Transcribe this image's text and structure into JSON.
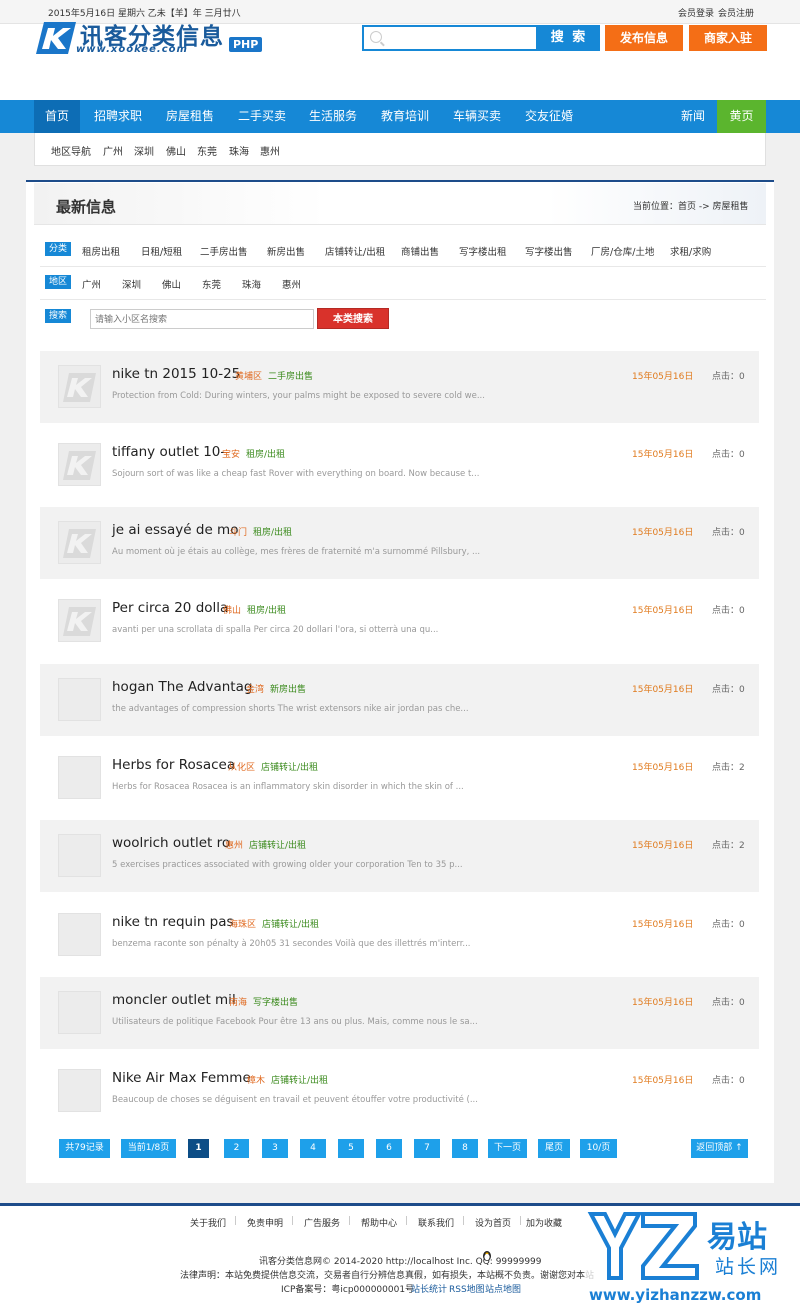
{
  "topbar": {
    "date": "2015年5月16日 星期六 乙未【羊】年 三月廿八",
    "login": "会员登录",
    "register": "会员注册"
  },
  "logo": {
    "name": "讯客分类信息",
    "url": "www.xookee.com",
    "badge": "PHP"
  },
  "search": {
    "placeholder": "",
    "button": "搜 索"
  },
  "header_buttons": {
    "publish": "发布信息",
    "merchant": "商家入驻"
  },
  "nav": {
    "items": [
      "首页",
      "招聘求职",
      "房屋租售",
      "二手买卖",
      "生活服务",
      "教育培训",
      "车辆买卖",
      "交友征婚"
    ],
    "news": "新闻",
    "yellow_pages": "黄页"
  },
  "region_nav": {
    "label": "地区导航",
    "items": [
      "广州",
      "深圳",
      "佛山",
      "东莞",
      "珠海",
      "惠州"
    ]
  },
  "latest": {
    "title": "最新信息",
    "breadcrumb": "当前位置：首页 -> 房屋租售"
  },
  "filters": {
    "category_tag": "分类",
    "categories": [
      "租房出租",
      "日租/短租",
      "二手房出售",
      "新房出售",
      "店铺转让/出租",
      "商铺出售",
      "写字楼出租",
      "写字楼出售",
      "厂房/仓库/土地",
      "求租/求购"
    ],
    "area_tag": "地区",
    "areas": [
      "广州",
      "深圳",
      "佛山",
      "东莞",
      "珠海",
      "惠州"
    ],
    "search_tag": "搜索",
    "keyword_placeholder": "请输入小区名搜索",
    "keyword_button": "本类搜索"
  },
  "listings": [
    {
      "title": "nike tn 2015 10-25",
      "area": "黄埔区",
      "category": "二手房出售",
      "desc": "Protection from Cold: During winters, your palms might be exposed to severe cold we...",
      "date": "15年05月16日",
      "clicks": "点击：0"
    },
    {
      "title": "tiffany outlet 10-",
      "area": "宝安",
      "category": "租房/出租",
      "desc": "Sojourn sort of was like a cheap fast Rover with everything on board. Now because t...",
      "date": "15年05月16日",
      "clicks": "点击：0"
    },
    {
      "title": "je ai essayé de mo",
      "area": "斗门",
      "category": "租房/出租",
      "desc": "Au moment où je étais au collège, mes frères de fraternité m'a surnommé Pillsbury, ...",
      "date": "15年05月16日",
      "clicks": "点击：0"
    },
    {
      "title": "Per circa 20 dolla",
      "area": "佛山",
      "category": "租房/出租",
      "desc": "avanti per una scrollata di spalla Per circa 20 dollari l'ora, si otterrà una qu...",
      "date": "15年05月16日",
      "clicks": "点击：0"
    },
    {
      "title": "hogan The Advantag",
      "area": "金湾",
      "category": "新房出售",
      "desc": "the advantages of compression shorts The wrist extensors nike air jordan pas che...",
      "date": "15年05月16日",
      "clicks": "点击：0"
    },
    {
      "title": "Herbs for Rosacea",
      "area": "从化区",
      "category": "店铺转让/出租",
      "desc": "Herbs for Rosacea Rosacea is an inflammatory skin disorder in which the skin of ...",
      "date": "15年05月16日",
      "clicks": "点击：2"
    },
    {
      "title": "woolrich outlet ro",
      "area": "惠州",
      "category": "店铺转让/出租",
      "desc": "5 exercises practices associated with growing older your corporation Ten to 35 p...",
      "date": "15年05月16日",
      "clicks": "点击：2"
    },
    {
      "title": "nike tn requin pas",
      "area": "海珠区",
      "category": "店铺转让/出租",
      "desc": "benzema raconte son pénalty à 20h05 31 secondes Voilà que des illettrés m'interr...",
      "date": "15年05月16日",
      "clicks": "点击：0"
    },
    {
      "title": "moncler outlet mil",
      "area": "南海",
      "category": "写字楼出售",
      "desc": "Utilisateurs de politique Facebook Pour être 13 ans ou plus. Mais, comme nous le sa...",
      "date": "15年05月16日",
      "clicks": "点击：0"
    },
    {
      "title": "Nike Air Max Femme",
      "area": "樟木",
      "category": "店铺转让/出租",
      "desc": "Beaucoup de choses se déguisent en travail et peuvent étouffer votre productivité (...",
      "date": "15年05月16日",
      "clicks": "点击：0"
    }
  ],
  "pagination": {
    "total": "共79记录",
    "current": "当前1/8页",
    "pages": [
      "1",
      "2",
      "3",
      "4",
      "5",
      "6",
      "7",
      "8"
    ],
    "next": "下一页",
    "last": "尾页",
    "per_page": "10/页",
    "back_top": "返回顶部 ↑"
  },
  "footer": {
    "links": [
      "关于我们",
      "免责申明",
      "广告服务",
      "帮助中心",
      "联系我们",
      "设为首页",
      "加为收藏"
    ],
    "copyright": "讯客分类信息网© 2014-2020 http://localhost Inc. QQ: 99999999",
    "disclaimer": "法律声明：本站免费提供信息交流，交易者自行分辨信息真假，如有损失，本站概不负责。谢谢您对本站",
    "icp": "ICP备案号：粤icp000000001号",
    "stats": "站长统计",
    "rss": "RSS地图",
    "sitemap": "站点地图"
  },
  "watermark": {
    "brand": "易站",
    "sub": "站长网",
    "url": "www.yizhanzzw.com"
  },
  "colors": {
    "primary": "#1688d6",
    "accent_orange": "#f46e16",
    "nav_green": "#5bb52e",
    "search_red": "#d9322b",
    "dark_blue": "#1d4c8a"
  }
}
